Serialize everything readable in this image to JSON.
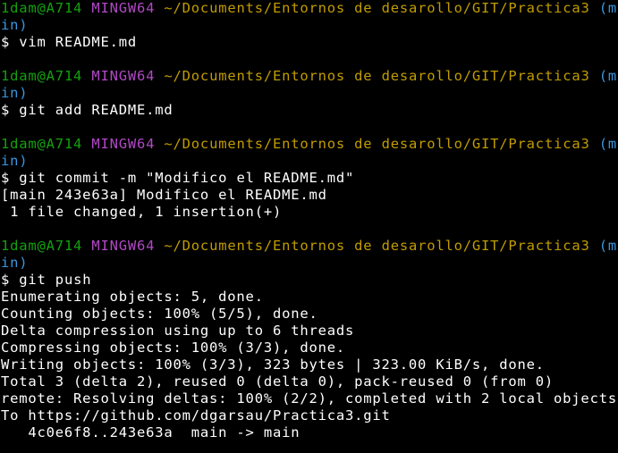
{
  "colors": {
    "background": "#000000",
    "user": "#13a10e",
    "host": "#b148c6",
    "path": "#c19c00",
    "branch": "#3a96dd",
    "text": "#ffffff"
  },
  "prompt": {
    "user_host": "1dam@A714",
    "shell": "MINGW64",
    "path": "~/Documents/Entornos de desarollo/GIT/Practica3",
    "branch_line1": "(ma",
    "branch_line2": "in)",
    "symbol": "$"
  },
  "blocks": [
    {
      "command": "vim README.md",
      "output": []
    },
    {
      "command": "git add README.md",
      "output": []
    },
    {
      "command": "git commit -m \"Modifico el README.md\"",
      "output": [
        "[main 243e63a] Modifico el README.md",
        " 1 file changed, 1 insertion(+)"
      ]
    },
    {
      "command": "git push",
      "output": [
        "Enumerating objects: 5, done.",
        "Counting objects: 100% (5/5), done.",
        "Delta compression using up to 6 threads",
        "Compressing objects: 100% (3/3), done.",
        "Writing objects: 100% (3/3), 323 bytes | 323.00 KiB/s, done.",
        "Total 3 (delta 2), reused 0 (delta 0), pack-reused 0 (from 0)",
        "remote: Resolving deltas: 100% (2/2), completed with 2 local objects.",
        "To https://github.com/dgarsau/Practica3.git",
        "   4c0e6f8..243e63a  main -> main"
      ]
    }
  ]
}
